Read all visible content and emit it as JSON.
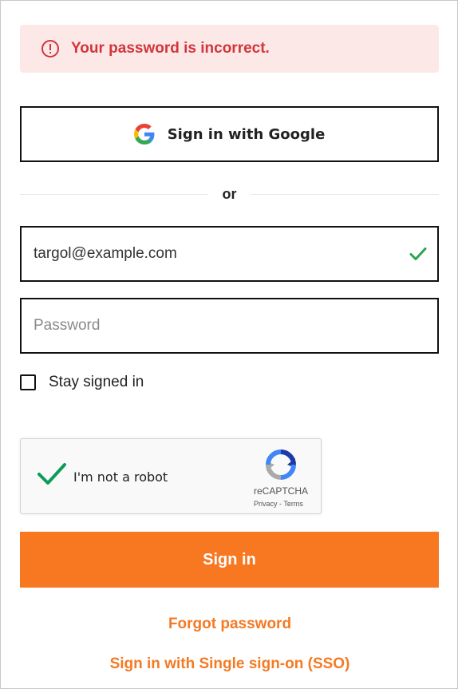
{
  "alert": {
    "message": "Your password is incorrect.",
    "icon": "error-circle-icon",
    "color": "#d1363a",
    "background": "#fde8e8"
  },
  "google_button": {
    "label": "Sign in with Google",
    "icon": "google-icon"
  },
  "divider": {
    "text": "or"
  },
  "email": {
    "value": "targol@example.com",
    "valid_icon": "checkmark-icon"
  },
  "password": {
    "placeholder": "Password",
    "value": ""
  },
  "stay_signed_in": {
    "label": "Stay signed in",
    "checked": false
  },
  "recaptcha": {
    "label": "I'm not a robot",
    "brand": "reCAPTCHA",
    "privacy": "Privacy",
    "separator": "-",
    "terms": "Terms",
    "checked": true
  },
  "sign_in_button": {
    "label": "Sign in",
    "color": "#f87721"
  },
  "links": {
    "forgot_password": "Forgot password",
    "sso": "Sign in with Single sign-on (SSO)",
    "color": "#f47a23"
  }
}
